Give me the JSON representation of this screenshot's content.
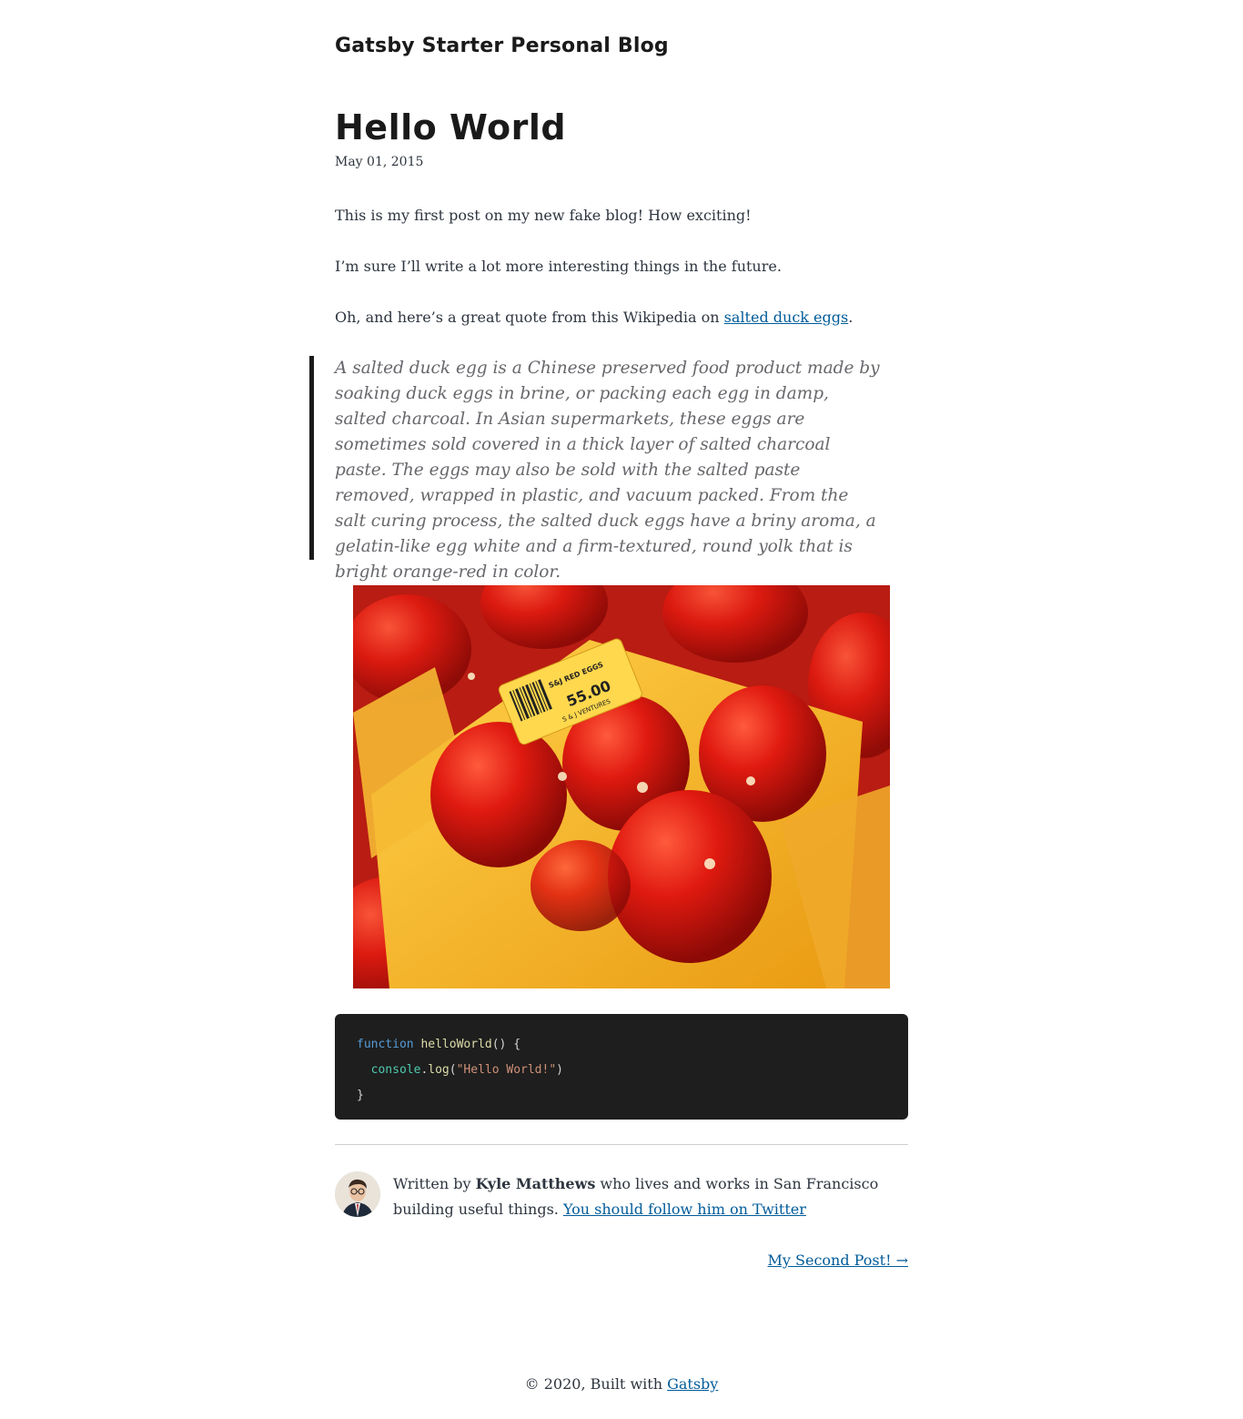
{
  "site": {
    "title": "Gatsby Starter Personal Blog"
  },
  "post": {
    "title": "Hello World",
    "date": "May 01, 2015",
    "paragraphs": [
      "This is my first post on my new fake blog! How exciting!",
      "I’m sure I’ll write a lot more interesting things in the future."
    ],
    "quote_intro_before": "Oh, and here’s a great quote from this Wikipedia on ",
    "quote_intro_link": "salted duck eggs",
    "quote_intro_after": ".",
    "blockquote": "A salted duck egg is a Chinese preserved food product made by soaking duck eggs in brine, or packing each egg in damp, salted charcoal. In Asian supermarkets, these eggs are sometimes sold covered in a thick layer of salted charcoal paste. The eggs may also be sold with the salted paste removed, wrapped in plastic, and vacuum packed. From the salt curing process, the salted duck eggs have a briny aroma, a gelatin-like egg white and a firm-textured, round yolk that is bright orange-red in color.",
    "image_labels": {
      "text_a": "S&J RED EGGS",
      "text_b": "55.00",
      "text_c": "S & J VENTURES"
    },
    "code": {
      "kw": "function",
      "fn": "helloWorld",
      "sig_rest": "() {",
      "indent": "  ",
      "obj": "console",
      "dot": ".",
      "method": "log",
      "open": "(",
      "str": "\"Hello World!\"",
      "close": ")",
      "end": "}"
    }
  },
  "bio": {
    "prefix": "Written by ",
    "author": "Kyle Matthews",
    "middle": " who lives and works in San Francisco building useful things. ",
    "twitter_link": "You should follow him on Twitter"
  },
  "nav": {
    "next": "My Second Post! →"
  },
  "footer": {
    "prefix": "© 2020, Built with ",
    "link": "Gatsby"
  },
  "colors": {
    "link": "#005b99",
    "code_bg": "#1e1e1e",
    "quote_border": "#1a1a1a"
  }
}
